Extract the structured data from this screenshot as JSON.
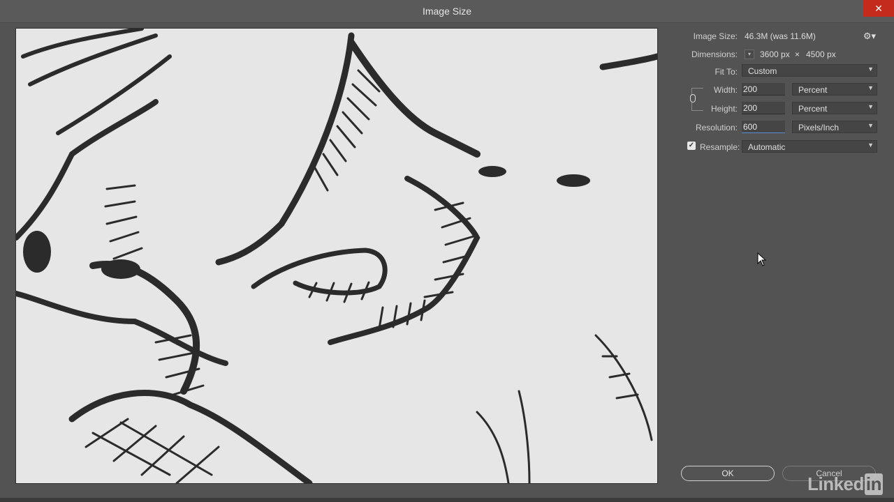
{
  "window": {
    "title": "Image Size",
    "close_glyph": "✕"
  },
  "panel": {
    "image_size_label": "Image Size:",
    "image_size_value": "46.3M (was 11.6M)",
    "dimensions_label": "Dimensions:",
    "dimensions_width": "3600 px",
    "dimensions_x": "×",
    "dimensions_height": "4500 px",
    "fit_to_label": "Fit To:",
    "fit_to_value": "Custom",
    "width_label": "Width:",
    "width_value": "200",
    "width_unit": "Percent",
    "height_label": "Height:",
    "height_value": "200",
    "height_unit": "Percent",
    "resolution_label": "Resolution:",
    "resolution_value": "600",
    "resolution_unit": "Pixels/Inch",
    "resample_label": "Resample:",
    "resample_checked": true,
    "resample_value": "Automatic"
  },
  "buttons": {
    "ok": "OK",
    "cancel": "Cancel"
  },
  "watermark": {
    "text": "Linked",
    "box": "in"
  },
  "icons": {
    "gear": "gear-icon",
    "chain": "link-icon",
    "close": "close-icon"
  },
  "colors": {
    "close": "#c42b1c",
    "focus": "#5a8fd6",
    "background": "#535353",
    "preview": "#e6e6e6"
  }
}
